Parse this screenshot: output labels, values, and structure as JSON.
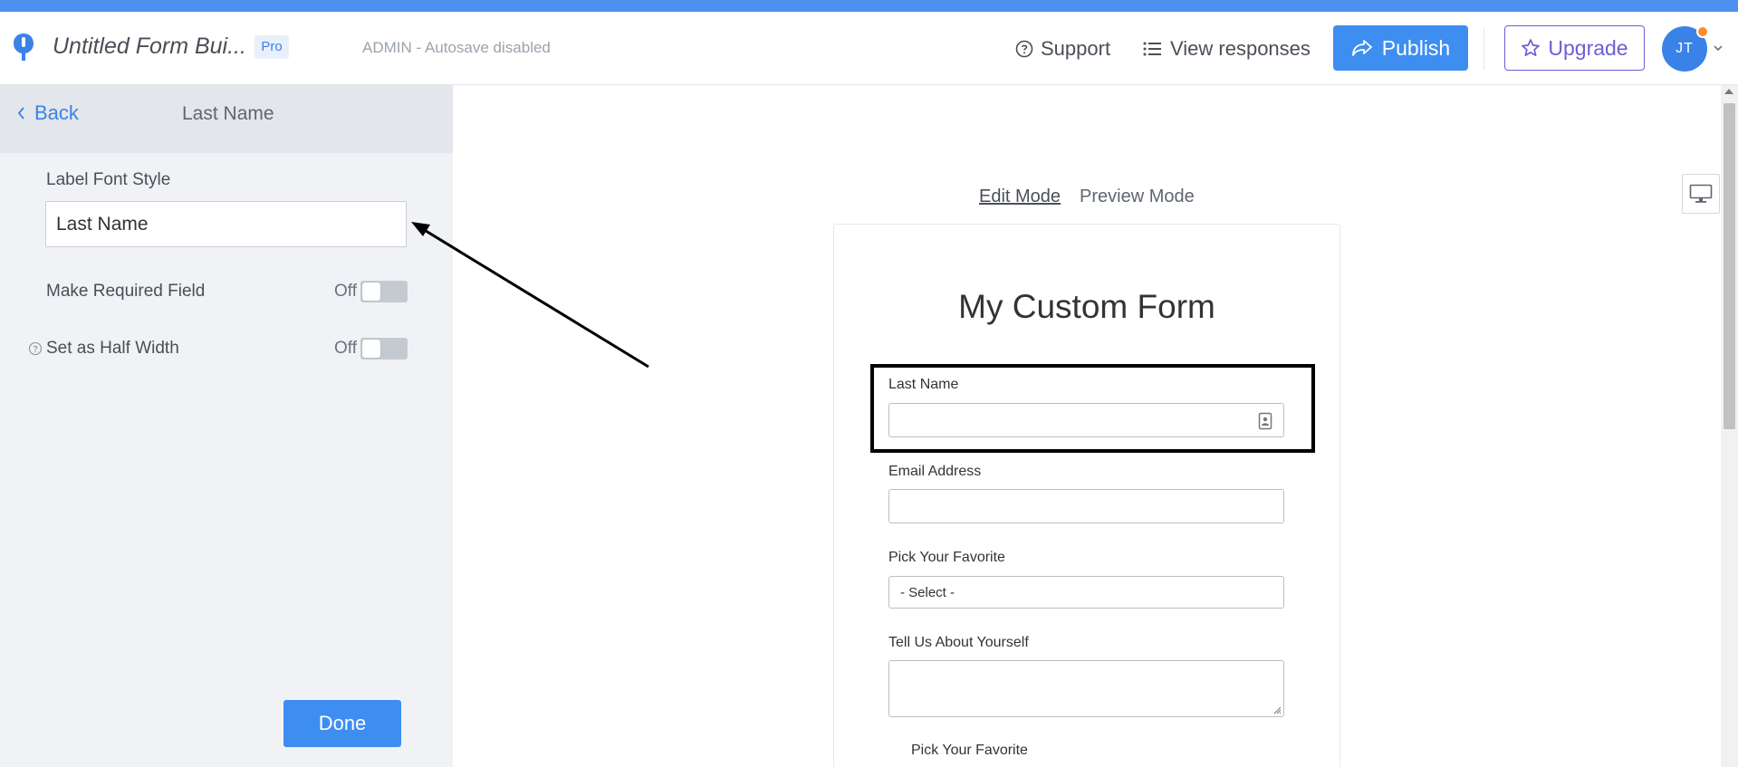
{
  "header": {
    "form_title": "Untitled Form Bui...",
    "badge": "Pro",
    "status": "ADMIN - Autosave disabled",
    "support_label": "Support",
    "view_responses_label": "View responses",
    "publish_label": "Publish",
    "upgrade_label": "Upgrade",
    "avatar_initials": "JT"
  },
  "sidebar": {
    "back_label": "Back",
    "panel_title": "Last Name",
    "label_font_style_title": "Label Font Style",
    "label_value": "Last Name",
    "required_label": "Make Required Field",
    "required_state": "Off",
    "half_width_label": "Set as Half Width",
    "half_width_state": "Off",
    "done_label": "Done"
  },
  "canvas": {
    "edit_mode_label": "Edit Mode",
    "preview_mode_label": "Preview Mode",
    "form_heading": "My Custom Form",
    "fields": [
      {
        "label": "Last Name",
        "type": "text"
      },
      {
        "label": "Email Address",
        "type": "text"
      },
      {
        "label": "Pick Your Favorite",
        "type": "select",
        "value": "- Select -"
      },
      {
        "label": "Tell Us About Yourself",
        "type": "textarea"
      },
      {
        "label": "Pick Your Favorite",
        "type": "radio"
      }
    ]
  },
  "colors": {
    "accent": "#3d8ef0",
    "upgrade": "#6a5fd3",
    "top_stripe": "#4d90f0",
    "notification_dot": "#ff8c2a"
  }
}
